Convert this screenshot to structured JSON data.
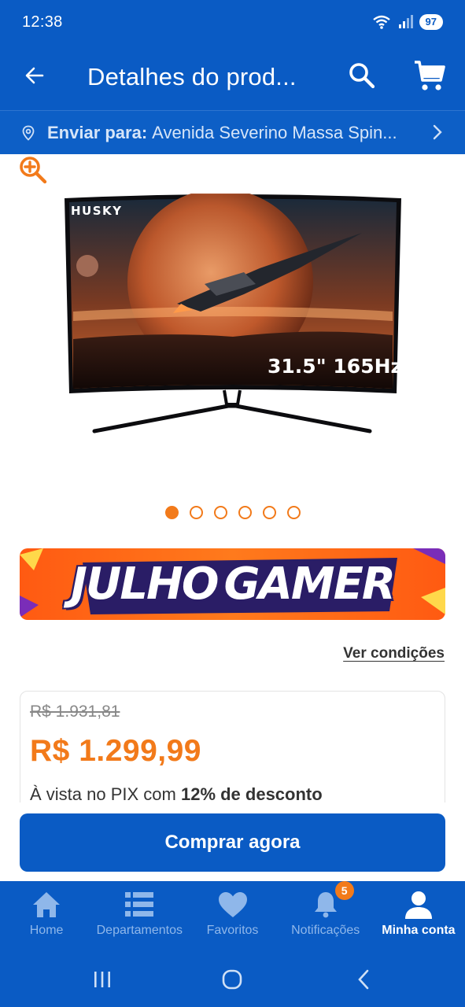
{
  "status_bar": {
    "time": "12:38",
    "battery": "97"
  },
  "app_bar": {
    "title": "Detalhes do prod..."
  },
  "delivery": {
    "label": "Enviar para:",
    "address": "Avenida Severino Massa Spin..."
  },
  "product": {
    "brand": "HUSKY",
    "spec": "31.5\" 165Hz",
    "carousel_total": 6,
    "carousel_active": 1
  },
  "promo": {
    "word1": "JULHO",
    "word2": "GAMER"
  },
  "conditions_link": "Ver condições",
  "pricing": {
    "old_price": "R$ 1.931,81",
    "new_price": "R$ 1.299,99",
    "pix_prefix": "À vista no PIX com ",
    "pix_discount": "12% de desconto"
  },
  "buy_button": "Comprar agora",
  "bottom_nav": {
    "items": [
      {
        "label": "Home",
        "icon": "home-icon"
      },
      {
        "label": "Departamentos",
        "icon": "list-icon"
      },
      {
        "label": "Favoritos",
        "icon": "heart-icon"
      },
      {
        "label": "Notificações",
        "icon": "bell-icon",
        "badge": "5"
      },
      {
        "label": "Minha conta",
        "icon": "user-icon",
        "active": true
      }
    ]
  },
  "colors": {
    "primary": "#0a5bc4",
    "accent": "#f27a1a"
  }
}
